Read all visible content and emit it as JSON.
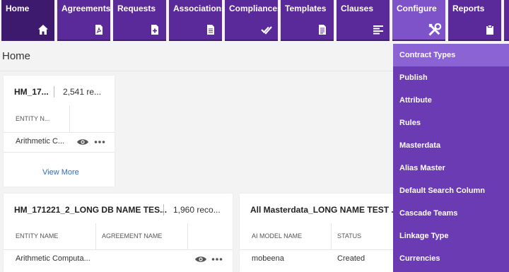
{
  "nav": {
    "tiles": [
      {
        "label": "Home",
        "icon": "home-icon"
      },
      {
        "label": "Agreements",
        "icon": "pdf-file-icon"
      },
      {
        "label": "Requests",
        "icon": "add-file-icon"
      },
      {
        "label": "Associations",
        "icon": "document-icon"
      },
      {
        "label": "Compliances",
        "icon": "double-check-icon"
      },
      {
        "label": "Templates",
        "icon": "template-icon"
      },
      {
        "label": "Clauses",
        "icon": "align-left-icon"
      },
      {
        "label": "Configure",
        "icon": "tools-icon"
      },
      {
        "label": "Reports",
        "icon": "clipboard-icon"
      }
    ],
    "active": "Configure"
  },
  "page": {
    "title": "Home"
  },
  "cards": [
    {
      "title": "HM_17...",
      "count": "2,541 re...",
      "columns": [
        "ENTITY N..."
      ],
      "row": [
        "Arithmetic C..."
      ],
      "view_more": "View More"
    },
    {
      "title": "HM_171221_2_LONG DB NAME TES...",
      "count": "1,960 reco...",
      "columns": [
        "ENTITY NAME",
        "AGREEMENT NAME"
      ],
      "row": [
        "Arithmetic Computa..."
      ]
    },
    {
      "title": "All Masterdata_LONG NAME TEST ...",
      "columns": [
        "AI MODEL NAME",
        "STATUS"
      ],
      "row": [
        "mobeena",
        "Created"
      ]
    }
  ],
  "configure_menu": {
    "items": [
      "Contract Types",
      "Publish",
      "Attribute",
      "Rules",
      "Masterdata",
      "Alias Master",
      "Default Search Column",
      "Cascade Teams",
      "Linkage Type",
      "Currencies"
    ],
    "highlighted": "Contract Types"
  },
  "colors": {
    "nav_tile": "#5a2a9b",
    "nav_home": "#3d1a6e",
    "nav_active": "#7e52c8",
    "menu_bg": "#6a3bb3",
    "menu_highlight": "#8b63d4",
    "link": "#2f6db3"
  }
}
